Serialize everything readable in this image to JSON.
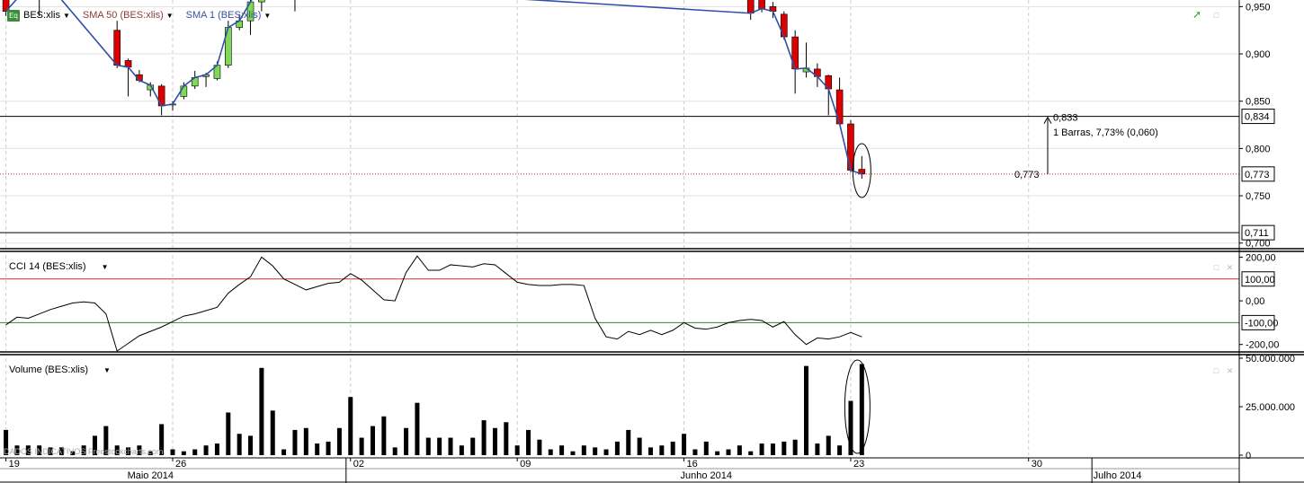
{
  "colors": {
    "background": "#ffffff",
    "grid": "#cccccc",
    "price_line": "#2f4fa8",
    "candle_down": "#dd0000",
    "candle_up": "#7fd957",
    "cci_upper_level": "#c0392b",
    "cci_lower_level": "#2e8b2e",
    "axis_text": "#000000"
  },
  "legend": {
    "symbol_badge": "Eq",
    "symbol": "BES:xlis",
    "sma50": "SMA 50 (BES:xlis)",
    "sma1": "SMA 1 (BES:xlis)",
    "cci": "CCI 14 (BES:xlis)",
    "volume": "Volume (BES:xlis)",
    "watermark": "DADOS INDICATIVOS Freestockcharts.com",
    "sma50_color": "#8b3a3a",
    "sma1_color": "#3b4fa0"
  },
  "icons": [
    "trend-icon",
    "panel-restore-icon",
    "panel-close-icon",
    "dropdown-arrow-icon"
  ],
  "chart_data": [
    {
      "type": "candlestick",
      "title": "BES:xlis",
      "ylim": [
        0.695,
        0.957
      ],
      "yticks": [
        "0,950",
        "0,900",
        "0,850",
        "0,800",
        "0,750",
        "0,700"
      ],
      "horizontal_lines": [
        0.834,
        0.711
      ],
      "dotted_line": 0.773,
      "right_labels": [
        "0,834",
        "0,773",
        "0,711"
      ],
      "annotation": {
        "from": 0.773,
        "to": 0.833,
        "text_top": "0,833",
        "text_mid": "1 Barras, 7,73% (0,060)",
        "text_bottom": "0,773"
      },
      "candles": [
        {
          "slot": 0,
          "o": 0.98,
          "h": 0.985,
          "l": 0.94,
          "c": 0.945
        },
        {
          "slot": 3,
          "o": 0.985,
          "h": 0.99,
          "l": 0.94,
          "c": 0.985
        },
        {
          "slot": 10,
          "o": 0.925,
          "h": 0.935,
          "l": 0.885,
          "c": 0.888
        },
        {
          "slot": 11,
          "o": 0.893,
          "h": 0.895,
          "l": 0.855,
          "c": 0.886
        },
        {
          "slot": 12,
          "o": 0.878,
          "h": 0.883,
          "l": 0.87,
          "c": 0.872
        },
        {
          "slot": 13,
          "o": 0.862,
          "h": 0.87,
          "l": 0.855,
          "c": 0.867
        },
        {
          "slot": 14,
          "o": 0.866,
          "h": 0.868,
          "l": 0.835,
          "c": 0.845
        },
        {
          "slot": 15,
          "o": 0.846,
          "h": 0.85,
          "l": 0.84,
          "c": 0.847
        },
        {
          "slot": 16,
          "o": 0.855,
          "h": 0.87,
          "l": 0.852,
          "c": 0.866
        },
        {
          "slot": 17,
          "o": 0.866,
          "h": 0.882,
          "l": 0.863,
          "c": 0.875
        },
        {
          "slot": 18,
          "o": 0.876,
          "h": 0.88,
          "l": 0.865,
          "c": 0.878
        },
        {
          "slot": 19,
          "o": 0.874,
          "h": 0.892,
          "l": 0.872,
          "c": 0.888
        },
        {
          "slot": 20,
          "o": 0.888,
          "h": 0.935,
          "l": 0.885,
          "c": 0.928
        },
        {
          "slot": 21,
          "o": 0.928,
          "h": 0.942,
          "l": 0.925,
          "c": 0.935
        },
        {
          "slot": 22,
          "o": 0.935,
          "h": 0.96,
          "l": 0.92,
          "c": 0.955
        },
        {
          "slot": 23,
          "o": 0.955,
          "h": 0.985,
          "l": 0.945,
          "c": 0.975
        },
        {
          "slot": 26,
          "o": 0.975,
          "h": 0.985,
          "l": 0.945,
          "c": 0.978
        },
        {
          "slot": 67,
          "o": 0.985,
          "h": 0.99,
          "l": 0.936,
          "c": 0.943
        },
        {
          "slot": 68,
          "o": 0.975,
          "h": 0.985,
          "l": 0.944,
          "c": 0.948
        },
        {
          "slot": 69,
          "o": 0.95,
          "h": 0.955,
          "l": 0.938,
          "c": 0.945
        },
        {
          "slot": 70,
          "o": 0.942,
          "h": 0.945,
          "l": 0.915,
          "c": 0.918
        },
        {
          "slot": 71,
          "o": 0.918,
          "h": 0.925,
          "l": 0.858,
          "c": 0.884
        },
        {
          "slot": 72,
          "o": 0.881,
          "h": 0.912,
          "l": 0.875,
          "c": 0.885
        },
        {
          "slot": 73,
          "o": 0.884,
          "h": 0.89,
          "l": 0.865,
          "c": 0.876
        },
        {
          "slot": 74,
          "o": 0.877,
          "h": 0.878,
          "l": 0.835,
          "c": 0.863
        },
        {
          "slot": 75,
          "o": 0.862,
          "h": 0.875,
          "l": 0.83,
          "c": 0.826
        },
        {
          "slot": 76,
          "o": 0.826,
          "h": 0.83,
          "l": 0.775,
          "c": 0.777
        },
        {
          "slot": 77,
          "o": 0.778,
          "h": 0.792,
          "l": 0.768,
          "c": 0.773
        }
      ],
      "close_line": [
        [
          0,
          0.945
        ],
        [
          3,
          0.985
        ],
        [
          10,
          0.888
        ],
        [
          11,
          0.886
        ],
        [
          12,
          0.872
        ],
        [
          13,
          0.867
        ],
        [
          14,
          0.845
        ],
        [
          15,
          0.847
        ],
        [
          16,
          0.866
        ],
        [
          17,
          0.875
        ],
        [
          18,
          0.878
        ],
        [
          19,
          0.888
        ],
        [
          20,
          0.928
        ],
        [
          21,
          0.935
        ],
        [
          22,
          0.955
        ],
        [
          23,
          0.975
        ],
        [
          67,
          0.943
        ],
        [
          68,
          0.948
        ],
        [
          69,
          0.945
        ],
        [
          70,
          0.918
        ],
        [
          71,
          0.884
        ],
        [
          72,
          0.885
        ],
        [
          73,
          0.876
        ],
        [
          74,
          0.863
        ],
        [
          75,
          0.826
        ],
        [
          76,
          0.777
        ],
        [
          77,
          0.773
        ]
      ]
    },
    {
      "type": "line",
      "title": "CCI 14 (BES:xlis)",
      "ylim": [
        -230,
        210
      ],
      "yticks": [
        "200,00",
        "0,00",
        "-200,00"
      ],
      "levels": [
        100,
        -100
      ],
      "level_labels": [
        "100,00",
        "-100,00"
      ],
      "values": [
        [
          0,
          -110
        ],
        [
          1,
          -75
        ],
        [
          2,
          -80
        ],
        [
          3,
          -60
        ],
        [
          4,
          -40
        ],
        [
          5,
          -25
        ],
        [
          6,
          -10
        ],
        [
          7,
          -5
        ],
        [
          8,
          -10
        ],
        [
          9,
          -60
        ],
        [
          10,
          -230
        ],
        [
          11,
          -195
        ],
        [
          12,
          -160
        ],
        [
          13,
          -140
        ],
        [
          14,
          -120
        ],
        [
          15,
          -95
        ],
        [
          16,
          -70
        ],
        [
          17,
          -60
        ],
        [
          18,
          -45
        ],
        [
          19,
          -30
        ],
        [
          20,
          35
        ],
        [
          21,
          75
        ],
        [
          22,
          110
        ],
        [
          23,
          200
        ],
        [
          24,
          160
        ],
        [
          25,
          100
        ],
        [
          26,
          75
        ],
        [
          27,
          50
        ],
        [
          28,
          65
        ],
        [
          29,
          80
        ],
        [
          30,
          85
        ],
        [
          31,
          125
        ],
        [
          32,
          95
        ],
        [
          33,
          50
        ],
        [
          34,
          5
        ],
        [
          35,
          0
        ],
        [
          36,
          130
        ],
        [
          37,
          205
        ],
        [
          38,
          140
        ],
        [
          39,
          140
        ],
        [
          40,
          165
        ],
        [
          41,
          160
        ],
        [
          42,
          155
        ],
        [
          43,
          170
        ],
        [
          44,
          165
        ],
        [
          45,
          125
        ],
        [
          46,
          85
        ],
        [
          47,
          75
        ],
        [
          48,
          70
        ],
        [
          49,
          70
        ],
        [
          50,
          75
        ],
        [
          51,
          75
        ],
        [
          52,
          70
        ],
        [
          53,
          -80
        ],
        [
          54,
          -165
        ],
        [
          55,
          -175
        ],
        [
          56,
          -140
        ],
        [
          57,
          -155
        ],
        [
          58,
          -135
        ],
        [
          59,
          -155
        ],
        [
          60,
          -135
        ],
        [
          61,
          -100
        ],
        [
          62,
          -125
        ],
        [
          63,
          -130
        ],
        [
          64,
          -120
        ],
        [
          65,
          -100
        ],
        [
          66,
          -90
        ],
        [
          67,
          -85
        ],
        [
          68,
          -90
        ],
        [
          69,
          -120
        ],
        [
          70,
          -95
        ],
        [
          71,
          -155
        ],
        [
          72,
          -200
        ],
        [
          73,
          -170
        ],
        [
          74,
          -175
        ],
        [
          75,
          -165
        ],
        [
          76,
          -145
        ],
        [
          77,
          -165
        ]
      ]
    },
    {
      "type": "bar",
      "title": "Volume (BES:xlis)",
      "ylim": [
        0,
        50000000
      ],
      "yticks": [
        "50.000.000",
        "25.000.000",
        "0"
      ],
      "values": [
        [
          0,
          13000000
        ],
        [
          1,
          5000000
        ],
        [
          2,
          5000000
        ],
        [
          3,
          5000000
        ],
        [
          4,
          4000000
        ],
        [
          5,
          4000000
        ],
        [
          6,
          2000000
        ],
        [
          7,
          5000000
        ],
        [
          8,
          10000000
        ],
        [
          9,
          15000000
        ],
        [
          10,
          5000000
        ],
        [
          11,
          4000000
        ],
        [
          12,
          5000000
        ],
        [
          13,
          2000000
        ],
        [
          14,
          16000000
        ],
        [
          15,
          3000000
        ],
        [
          16,
          2000000
        ],
        [
          17,
          3000000
        ],
        [
          18,
          5000000
        ],
        [
          19,
          6000000
        ],
        [
          20,
          22000000
        ],
        [
          21,
          11000000
        ],
        [
          22,
          10000000
        ],
        [
          23,
          45000000
        ],
        [
          24,
          23000000
        ],
        [
          25,
          3000000
        ],
        [
          26,
          13000000
        ],
        [
          27,
          14000000
        ],
        [
          28,
          6000000
        ],
        [
          29,
          7000000
        ],
        [
          30,
          14000000
        ],
        [
          31,
          30000000
        ],
        [
          32,
          9000000
        ],
        [
          33,
          15000000
        ],
        [
          34,
          20000000
        ],
        [
          35,
          4000000
        ],
        [
          36,
          14000000
        ],
        [
          37,
          27000000
        ],
        [
          38,
          9000000
        ],
        [
          39,
          9000000
        ],
        [
          40,
          9000000
        ],
        [
          41,
          5000000
        ],
        [
          42,
          9000000
        ],
        [
          43,
          18000000
        ],
        [
          44,
          14000000
        ],
        [
          45,
          17000000
        ],
        [
          46,
          5000000
        ],
        [
          47,
          13000000
        ],
        [
          48,
          8000000
        ],
        [
          49,
          3000000
        ],
        [
          50,
          5000000
        ],
        [
          51,
          2000000
        ],
        [
          52,
          5000000
        ],
        [
          53,
          4000000
        ],
        [
          54,
          3000000
        ],
        [
          55,
          7000000
        ],
        [
          56,
          13000000
        ],
        [
          57,
          9000000
        ],
        [
          58,
          4000000
        ],
        [
          59,
          5000000
        ],
        [
          60,
          7000000
        ],
        [
          61,
          11000000
        ],
        [
          62,
          3000000
        ],
        [
          63,
          7000000
        ],
        [
          64,
          2000000
        ],
        [
          65,
          3000000
        ],
        [
          66,
          5000000
        ],
        [
          67,
          2000000
        ],
        [
          68,
          6000000
        ],
        [
          69,
          6000000
        ],
        [
          70,
          7000000
        ],
        [
          71,
          8000000
        ],
        [
          72,
          46000000
        ],
        [
          73,
          6000000
        ],
        [
          74,
          10000000
        ],
        [
          75,
          5000000
        ],
        [
          76,
          28000000
        ],
        [
          77,
          47000000
        ]
      ]
    },
    {
      "type": "x-axis",
      "day_labels": [
        {
          "slot": 0,
          "text": "19"
        },
        {
          "slot": 15,
          "text": "26"
        },
        {
          "slot": 31,
          "text": "02"
        },
        {
          "slot": 46,
          "text": "09"
        },
        {
          "slot": 61,
          "text": "16"
        },
        {
          "slot": 76,
          "text": "23"
        },
        {
          "slot": 92,
          "text": "30"
        }
      ],
      "month_labels": [
        {
          "slot": 13,
          "text": "Maio 2014"
        },
        {
          "slot": 63,
          "text": "Junho 2014"
        },
        {
          "slot": 100,
          "text": "Julho 2014"
        }
      ],
      "month_separators": [
        30.6,
        97.7
      ]
    }
  ]
}
